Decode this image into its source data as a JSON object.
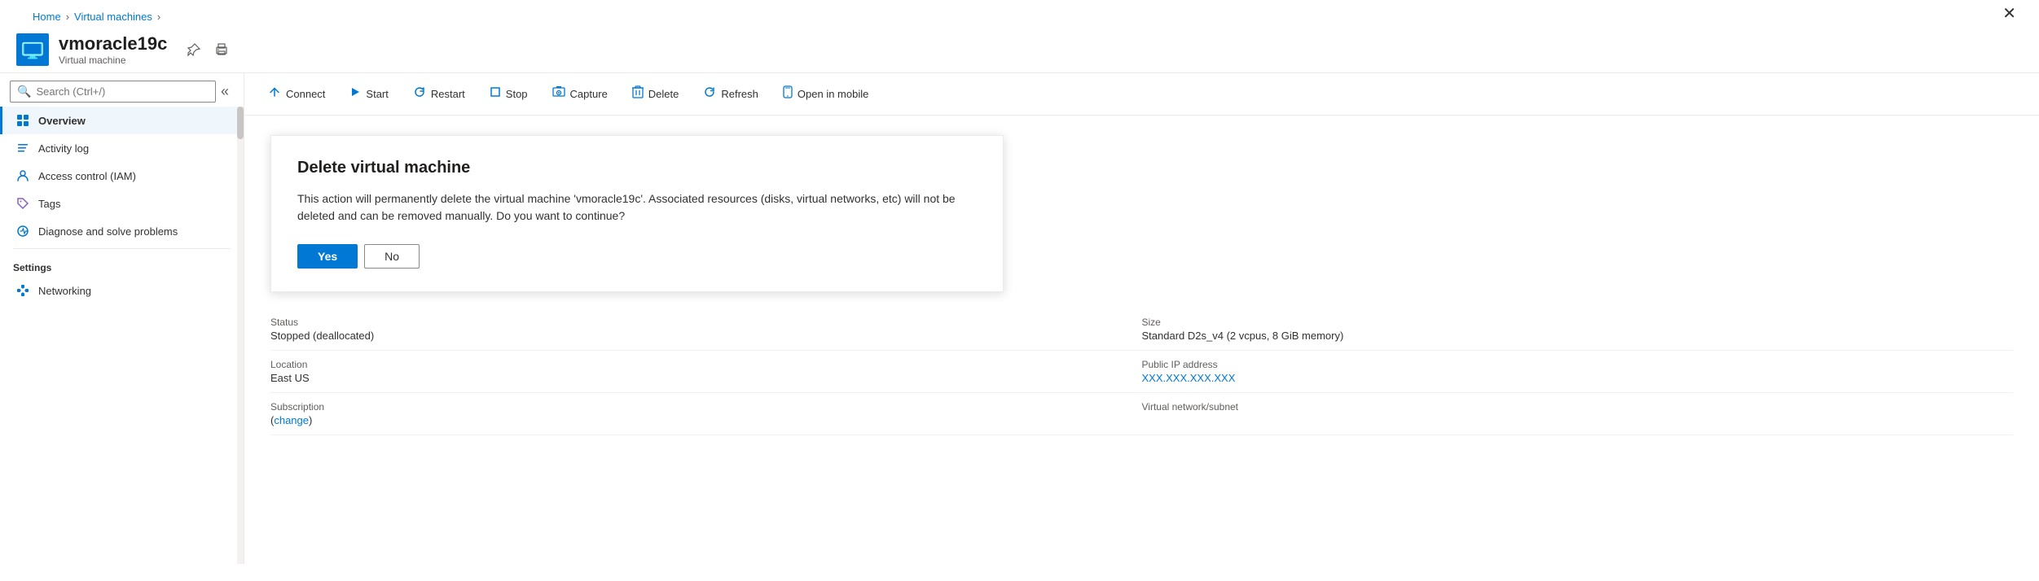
{
  "breadcrumb": {
    "home": "Home",
    "vms": "Virtual machines",
    "sep1": ">",
    "sep2": ">"
  },
  "header": {
    "vm_name": "vmoracle19c",
    "vm_type": "Virtual machine"
  },
  "toolbar": {
    "connect_label": "Connect",
    "start_label": "Start",
    "restart_label": "Restart",
    "stop_label": "Stop",
    "capture_label": "Capture",
    "delete_label": "Delete",
    "refresh_label": "Refresh",
    "open_in_mobile_label": "Open in mobile"
  },
  "sidebar": {
    "search_placeholder": "Search (Ctrl+/)",
    "nav_items": [
      {
        "id": "overview",
        "label": "Overview",
        "icon": "overview",
        "active": true
      },
      {
        "id": "activity-log",
        "label": "Activity log",
        "icon": "activity",
        "active": false
      },
      {
        "id": "access-control",
        "label": "Access control (IAM)",
        "icon": "iam",
        "active": false
      },
      {
        "id": "tags",
        "label": "Tags",
        "icon": "tags",
        "active": false
      },
      {
        "id": "diagnose",
        "label": "Diagnose and solve problems",
        "icon": "diagnose",
        "active": false
      }
    ],
    "settings_label": "Settings",
    "settings_items": [
      {
        "id": "networking",
        "label": "Networking",
        "icon": "networking",
        "active": false
      }
    ]
  },
  "dialog": {
    "title": "Delete virtual machine",
    "message": "This action will permanently delete the virtual machine 'vmoracle19c'. Associated resources (disks, virtual networks, etc) will not be deleted and can be removed manually. Do you want to continue?",
    "yes_label": "Yes",
    "no_label": "No"
  },
  "vm_info": {
    "status_label": "Status",
    "status_value": "Stopped (deallocated)",
    "location_label": "Location",
    "location_value": "East US",
    "subscription_label": "Subscription",
    "subscription_change": "change",
    "size_label": "Size",
    "size_value": "Standard D2s_v4 (2 vcpus, 8 GiB memory)",
    "public_ip_label": "Public IP address",
    "public_ip_value": "XXX.XXX.XXX.XXX",
    "vnet_label": "Virtual network/subnet"
  }
}
